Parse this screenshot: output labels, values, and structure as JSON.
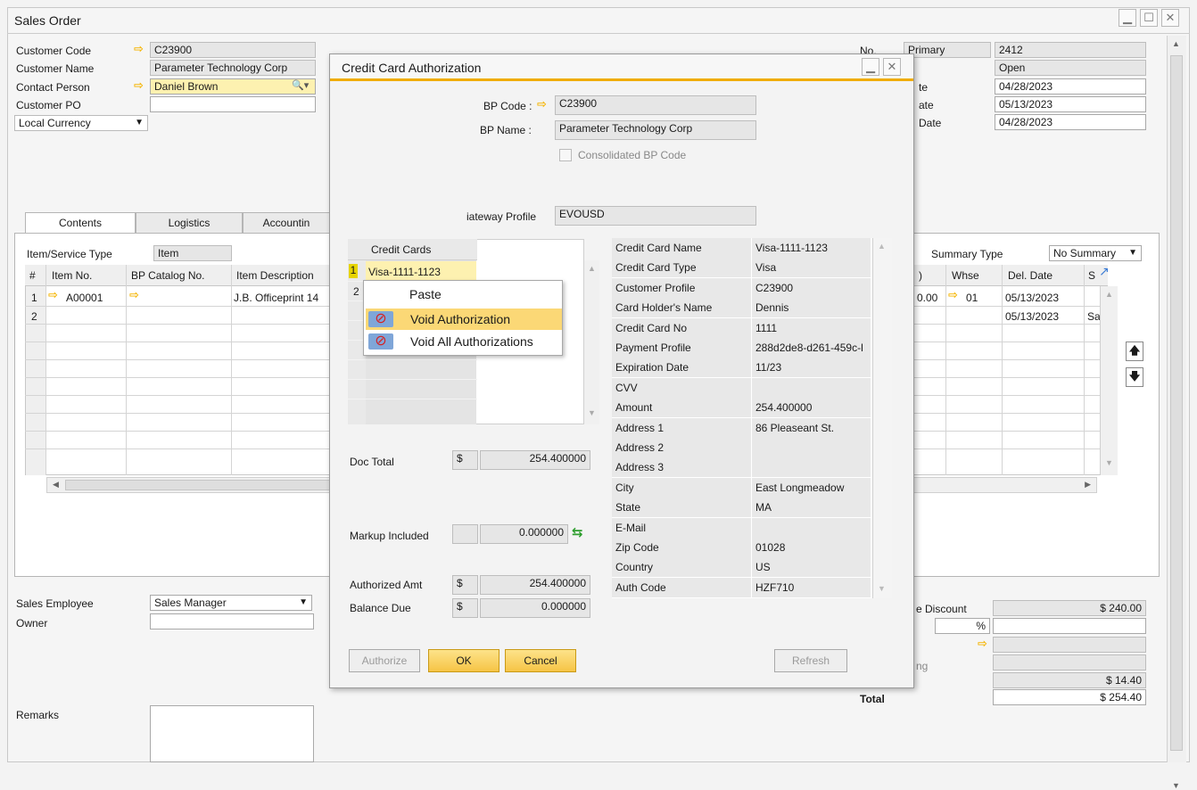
{
  "window": {
    "title": "Sales Order"
  },
  "header_left": {
    "customer_code_label": "Customer Code",
    "customer_code": "C23900",
    "customer_name_label": "Customer Name",
    "customer_name": "Parameter Technology Corp",
    "contact_person_label": "Contact Person",
    "contact_person": "Daniel Brown",
    "customer_po_label": "Customer PO",
    "customer_po": "",
    "currency": "Local Currency"
  },
  "header_right": {
    "no_label": "No.",
    "series": "Primary",
    "number": "2412",
    "status": "Open",
    "posting_label": "te",
    "posting_date": "04/28/2023",
    "delivery_label": "ate",
    "delivery_date": "05/13/2023",
    "document_label": "Date",
    "document_date": "04/28/2023"
  },
  "tabs": [
    "Contents",
    "Logistics",
    "Accountin"
  ],
  "contents": {
    "item_type_label": "Item/Service Type",
    "item_type": "Item",
    "summary_type_label": "Summary Type",
    "summary_type": "No Summary",
    "columns": [
      "#",
      "Item No.",
      "BP Catalog No.",
      "Item Description"
    ],
    "right_columns": [
      ")",
      "Whse",
      "Del. Date",
      "S"
    ],
    "rows": [
      {
        "num": "1",
        "item_no": "A00001",
        "description": "J.B. Officeprint 14",
        "amount": "0.00",
        "whse": "01",
        "del_date": "05/13/2023",
        "s": ""
      },
      {
        "num": "2",
        "item_no": "",
        "description": "",
        "amount": "",
        "whse": "",
        "del_date": "05/13/2023",
        "s": "Sa"
      }
    ]
  },
  "footer_left": {
    "sales_employee_label": "Sales Employee",
    "sales_employee": "Sales Manager",
    "owner_label": "Owner",
    "owner": "",
    "remarks_label": "Remarks"
  },
  "footer_right": {
    "discount_label": "e Discount",
    "discount_value": "$ 240.00",
    "percent_sign": "%",
    "rounding_label": "ng",
    "tax_value": "$ 14.40",
    "total_label": "Total",
    "total_value": "$ 254.40"
  },
  "dialog": {
    "title": "Credit Card Authorization",
    "bp_code_label": "BP Code :",
    "bp_code": "C23900",
    "bp_name_label": "BP Name :",
    "bp_name": "Parameter Technology Corp",
    "consolidated_label": "Consolidated BP Code",
    "gateway_label": "iateway Profile",
    "gateway_value": "EVOUSD",
    "cards_header": "Credit Cards",
    "cards": [
      {
        "num": "1",
        "name": "Visa-1111-1123"
      },
      {
        "num": "2",
        "name": ""
      }
    ],
    "context_menu": [
      "Paste",
      "Void Authorization",
      "Void All Authorizations"
    ],
    "doc_total_label": "Doc Total",
    "doc_total_currency": "$",
    "doc_total": "254.400000",
    "markup_label": "Markup Included",
    "markup_value": "0.000000",
    "authorized_label": "Authorized Amt",
    "authorized_currency": "$",
    "authorized_value": "254.400000",
    "balance_label": "Balance Due",
    "balance_currency": "$",
    "balance_value": "0.000000",
    "details": [
      {
        "k": "Credit Card Name",
        "v": "Visa-1111-1123"
      },
      {
        "k": "Credit Card Type",
        "v": "Visa"
      },
      {
        "k": "Customer Profile",
        "v": "C23900"
      },
      {
        "k": "Card Holder's Name",
        "v": "Dennis"
      },
      {
        "k": "Credit Card No",
        "v": "1111"
      },
      {
        "k": "Payment Profile",
        "v": "288d2de8-d261-459c-l"
      },
      {
        "k": "Expiration Date",
        "v": "11/23"
      },
      {
        "k": "CVV",
        "v": ""
      },
      {
        "k": "Amount",
        "v": "254.400000"
      },
      {
        "k": "Address 1",
        "v": "86 Pleaseant St."
      },
      {
        "k": "Address 2",
        "v": ""
      },
      {
        "k": "Address 3",
        "v": ""
      },
      {
        "k": "City",
        "v": "East Longmeadow"
      },
      {
        "k": "State",
        "v": "MA"
      },
      {
        "k": "E-Mail",
        "v": ""
      },
      {
        "k": "Zip Code",
        "v": "01028"
      },
      {
        "k": "Country",
        "v": "US"
      },
      {
        "k": "Auth Code",
        "v": "HZF710"
      }
    ],
    "buttons": {
      "authorize": "Authorize",
      "ok": "OK",
      "cancel": "Cancel",
      "refresh": "Refresh"
    }
  },
  "icons": {
    "link_arrow": "link-arrow-icon",
    "void": "void-card-icon",
    "refresh_exchange": "exchange-icon"
  }
}
